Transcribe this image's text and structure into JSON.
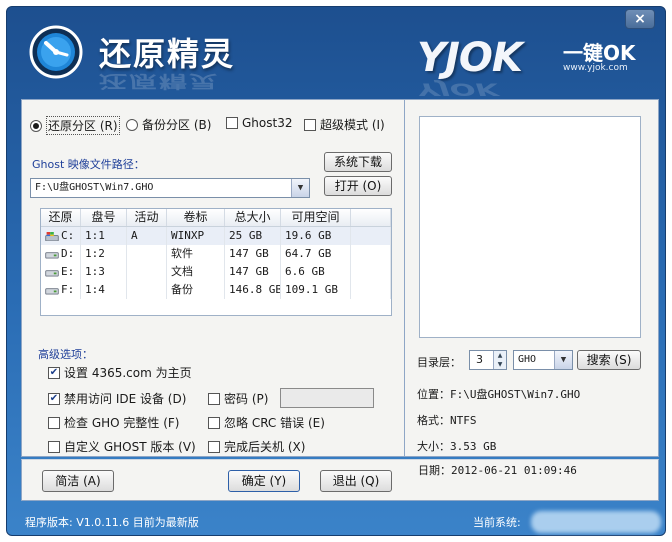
{
  "app": {
    "title": "还原精灵",
    "title_reflection": "还原精灵",
    "close_label": "×",
    "brand": "YJOK",
    "brand_tagline": "一键OK",
    "brand_url": "www.yjok.com",
    "brand_reflection": "YJOK"
  },
  "mode": {
    "restore_label": "还原分区 (R)",
    "backup_label": "备份分区 (B)",
    "ghost32_label": "Ghost32",
    "super_mode_label": "超级模式 (I)",
    "selected": "restore",
    "ghost32_checked": false,
    "super_mode_checked": false
  },
  "image": {
    "path_label": "Ghost 映像文件路径：",
    "path_value": "F:\\U盘GHOST\\Win7.GHO",
    "download_button": "系统下载",
    "open_button": "打开 (O)"
  },
  "partitions": {
    "columns": [
      "还原",
      "盘号",
      "活动",
      "卷标",
      "总大小",
      "可用空间"
    ],
    "rows": [
      {
        "drive": "C:",
        "number": "1:1",
        "active": "A",
        "label": "WINXP",
        "total": "25 GB",
        "free": "19.6 GB",
        "selected": true
      },
      {
        "drive": "D:",
        "number": "1:2",
        "active": "",
        "label": "软件",
        "total": "147 GB",
        "free": "64.7 GB",
        "selected": false
      },
      {
        "drive": "E:",
        "number": "1:3",
        "active": "",
        "label": "文档",
        "total": "147 GB",
        "free": "6.6 GB",
        "selected": false
      },
      {
        "drive": "F:",
        "number": "1:4",
        "active": "",
        "label": "备份",
        "total": "146.8 GB",
        "free": "109.1 GB",
        "selected": false
      }
    ]
  },
  "advanced": {
    "title": "高级选项：",
    "homepage_label": "设置 4365.com 为主页",
    "homepage_checked": true,
    "disable_ide_label": "禁用访问 IDE 设备 (D)",
    "disable_ide_checked": true,
    "password_label": "密码 (P)",
    "password_checked": false,
    "check_gho_label": "检查 GHO 完整性 (F)",
    "check_gho_checked": false,
    "ignore_crc_label": "忽略 CRC 错误 (E)",
    "ignore_crc_checked": false,
    "custom_ghost_label": "自定义 GHOST 版本 (V)",
    "custom_ghost_checked": false,
    "shutdown_label": "完成后关机 (X)",
    "shutdown_checked": false
  },
  "details": {
    "dir_level_label": "目录层：",
    "dir_level_value": "3",
    "ext_value": "GHO",
    "search_button": "搜索 (S)",
    "location": "位置：F:\\U盘GHOST\\Win7.GHO",
    "format": "格式：NTFS",
    "size": "大小：3.53 GB",
    "date": "日期：2012-06-21  01:09:46"
  },
  "buttons": {
    "simple": "简洁 (A)",
    "ok": "确定 (Y)",
    "exit": "退出 (Q)"
  },
  "status": {
    "version": "程序版本: V1.0.11.6  目前为最新版",
    "current_system": "当前系统:"
  },
  "colors": {
    "title_bar": "#1d4f8f",
    "panel": "#f4f4f2",
    "accent_label": "#1f3f99"
  }
}
